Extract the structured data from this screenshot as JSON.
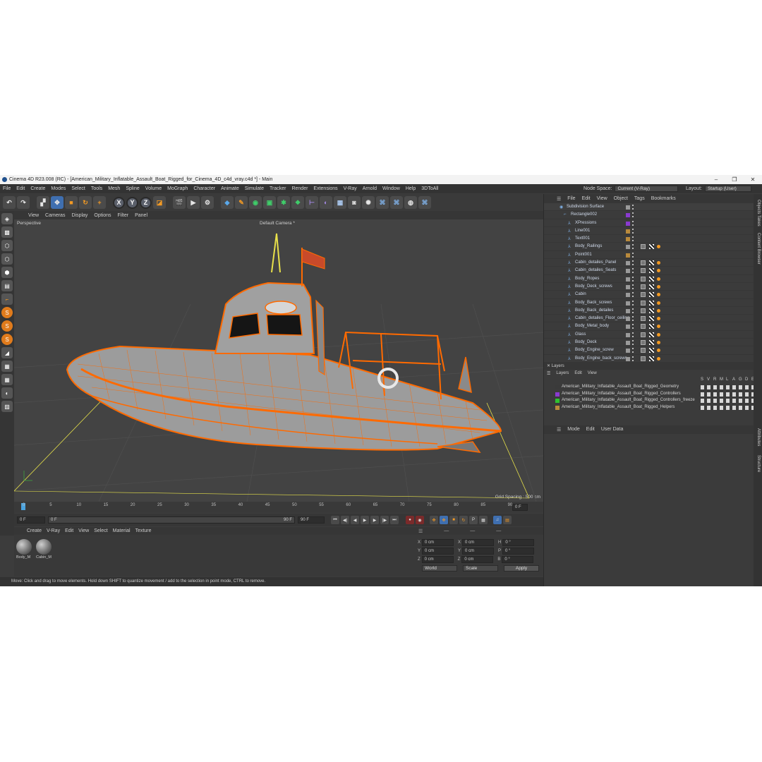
{
  "window": {
    "title": "Cinema 4D R23.008 (RC) - [American_Military_Inflatable_Assault_Boat_Rigged_for_Cinema_4D_c4d_vray.c4d *] - Main",
    "minimize": "–",
    "maximize": "❐",
    "close": "✕"
  },
  "menubar": {
    "items": [
      "File",
      "Edit",
      "Create",
      "Modes",
      "Select",
      "Tools",
      "Mesh",
      "Spline",
      "Volume",
      "MoGraph",
      "Character",
      "Animate",
      "Simulate",
      "Tracker",
      "Render",
      "Extensions",
      "V-Ray",
      "Arnold",
      "Window",
      "Help",
      "3DToAll"
    ],
    "node_space_label": "Node Space:",
    "node_space_value": "Current (V-Ray)",
    "layout_label": "Layout:",
    "layout_value": "Startup (User)"
  },
  "toolbar": {
    "icons": [
      "undo-icon",
      "redo-icon",
      "select-icon",
      "move-icon",
      "scale-icon",
      "rotate-icon",
      "create-icon",
      "x-axis-icon",
      "y-axis-icon",
      "z-axis-icon",
      "coord-system-icon",
      "render-view-icon",
      "render-picture-icon",
      "render-settings-icon",
      "cube-icon",
      "pen-icon",
      "subdivision-icon",
      "extrude-icon",
      "mograph-icon",
      "cloner-icon",
      "deformer-icon",
      "field-icon",
      "floor-icon",
      "camera-icon",
      "light-icon",
      "python-icon",
      "python2-icon",
      "globe-icon",
      "python3-icon"
    ],
    "axis_labels": [
      "X",
      "Y",
      "Z"
    ]
  },
  "viewport": {
    "menu": [
      "View",
      "Cameras",
      "Display",
      "Options",
      "Filter",
      "Panel"
    ],
    "projection": "Perspective",
    "camera": "Default Camera *",
    "grid_spacing": "Grid Spacing : 500 cm"
  },
  "timeline": {
    "ticks": [
      "0",
      "5",
      "10",
      "15",
      "20",
      "25",
      "30",
      "35",
      "40",
      "45",
      "50",
      "55",
      "60",
      "65",
      "70",
      "75",
      "80",
      "85",
      "90"
    ],
    "current_frame_box": "0 F",
    "start": "0 F",
    "start2": "0 F",
    "end": "90 F",
    "end2": "90 F"
  },
  "materials": {
    "menu": [
      "Create",
      "V-Ray",
      "Edit",
      "View",
      "Select",
      "Material",
      "Texture"
    ],
    "items": [
      {
        "name": "Body_M"
      },
      {
        "name": "Cabin_M"
      }
    ]
  },
  "coordinates": {
    "rows": [
      {
        "a": "X",
        "av": "0 cm",
        "b": "X",
        "bv": "0 cm",
        "c": "H",
        "cv": "0 °"
      },
      {
        "a": "Y",
        "av": "0 cm",
        "b": "Y",
        "bv": "0 cm",
        "c": "P",
        "cv": "0 °"
      },
      {
        "a": "Z",
        "av": "0 cm",
        "b": "Z",
        "bv": "0 cm",
        "c": "B",
        "cv": "0 °"
      }
    ],
    "world": "World",
    "scale": "Scale",
    "apply": "Apply"
  },
  "status": "Move: Click and drag to move elements. Hold down SHIFT to quantize movement / add to the selection in point mode, CTRL to remove.",
  "object_manager": {
    "menu": [
      "File",
      "Edit",
      "View",
      "Object",
      "Tags",
      "Bookmarks"
    ],
    "objects": [
      {
        "name": "Subdivision Surface",
        "indent": 0,
        "color": "#9a9a9a"
      },
      {
        "name": "Rectangle002",
        "indent": 1,
        "color": "#8a3ad0"
      },
      {
        "name": "XPressions",
        "indent": 2,
        "color": "#8a3ad0"
      },
      {
        "name": "Line001",
        "indent": 2,
        "color": "#b98a3c"
      },
      {
        "name": "Text001",
        "indent": 2,
        "color": "#b98a3c"
      },
      {
        "name": "Body_Railings",
        "indent": 2,
        "color": "#9a9a9a"
      },
      {
        "name": "Point001",
        "indent": 2,
        "color": "#b98a3c"
      },
      {
        "name": "Cabin_detailes_Panel",
        "indent": 2,
        "color": "#9a9a9a"
      },
      {
        "name": "Cabin_detailes_Seats",
        "indent": 2,
        "color": "#9a9a9a"
      },
      {
        "name": "Body_Ropes",
        "indent": 2,
        "color": "#9a9a9a"
      },
      {
        "name": "Body_Deck_screws",
        "indent": 2,
        "color": "#9a9a9a"
      },
      {
        "name": "Cabin",
        "indent": 2,
        "color": "#9a9a9a"
      },
      {
        "name": "Body_Back_screws",
        "indent": 2,
        "color": "#9a9a9a"
      },
      {
        "name": "Body_Back_detailes",
        "indent": 2,
        "color": "#9a9a9a"
      },
      {
        "name": "Cabin_detailes_Floor_ceiling",
        "indent": 2,
        "color": "#9a9a9a"
      },
      {
        "name": "Body_Metal_body",
        "indent": 2,
        "color": "#9a9a9a"
      },
      {
        "name": "Glass",
        "indent": 2,
        "color": "#9a9a9a"
      },
      {
        "name": "Body_Deck",
        "indent": 2,
        "color": "#9a9a9a"
      },
      {
        "name": "Body_Engine_screw",
        "indent": 2,
        "color": "#9a9a9a"
      },
      {
        "name": "Body_Engine_back_screws",
        "indent": 2,
        "color": "#9a9a9a"
      }
    ]
  },
  "layers": {
    "title": "Layers",
    "menu": [
      "Layers",
      "Edit",
      "View"
    ],
    "columns": [
      "S",
      "V",
      "R",
      "M",
      "L",
      "A",
      "G",
      "D",
      "E"
    ],
    "items": [
      {
        "name": "American_Military_Inflatable_Assault_Boat_Rigged_Geometry",
        "color": "#3a3a3a"
      },
      {
        "name": "American_Military_Inflatable_Assault_Boat_Rigged_Controllers",
        "color": "#8a3ad0"
      },
      {
        "name": "American_Military_Inflatable_Assault_Boat_Rigged_Controllers_freeze",
        "color": "#2fc12f"
      },
      {
        "name": "American_Military_Inflatable_Assault_Boat_Rigged_Helpers",
        "color": "#b98a3c"
      }
    ]
  },
  "attributes": {
    "menu": [
      "Mode",
      "Edit",
      "User Data"
    ]
  },
  "side_tabs": [
    "Objects",
    "Takes",
    "Content Browser",
    "Attributes",
    "Structure"
  ]
}
